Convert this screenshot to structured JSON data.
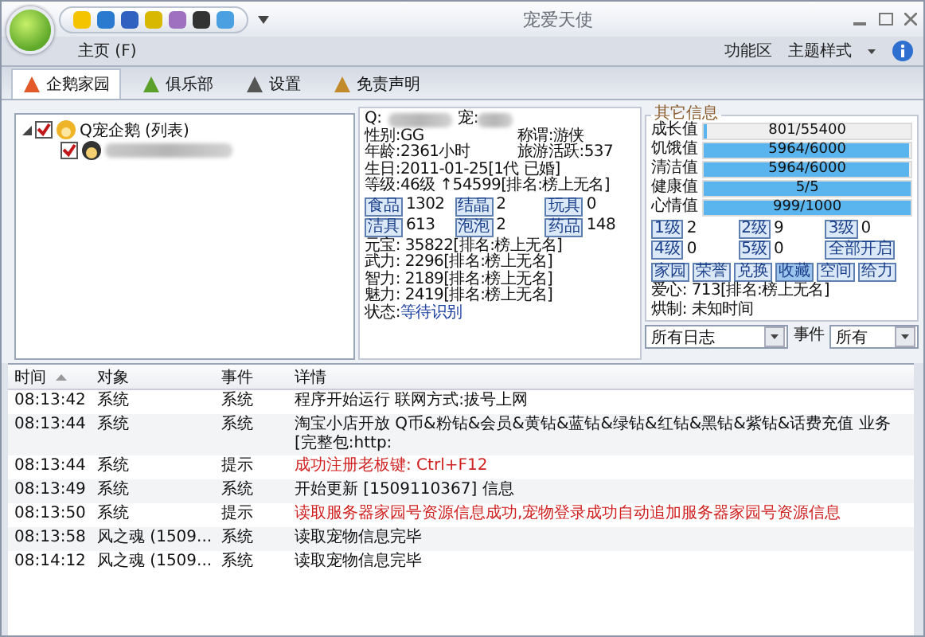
{
  "window": {
    "title": "宠爱天使"
  },
  "menu": {
    "left": [
      {
        "label": "主页 (F)"
      }
    ],
    "right": [
      {
        "label": "功能区"
      },
      {
        "label": "主题样式"
      }
    ]
  },
  "tabs": [
    {
      "label": "企鹅家园",
      "selected": true
    },
    {
      "label": "俱乐部",
      "selected": false
    },
    {
      "label": "设置",
      "selected": false
    },
    {
      "label": "免责声明",
      "selected": false
    }
  ],
  "tree": [
    {
      "label": "Q宠企鹅 (列表)",
      "checked": true,
      "expanded": true,
      "children": [
        {
          "checked": true
        }
      ]
    }
  ],
  "pet_info": {
    "q_label": "Q:",
    "pet_label": "宠:",
    "rows_top": [
      [
        "性别:GG",
        "称谓:游侠"
      ],
      [
        "年龄:2361小时",
        "旅游活跃:537"
      ],
      [
        "生日:2011-01-25[1代 已婚]"
      ],
      [
        "等级:46级 ↑54599[排名:榜上无名]"
      ]
    ],
    "items": [
      {
        "label": "食品",
        "value": "1302"
      },
      {
        "label": "结晶",
        "value": "2"
      },
      {
        "label": "玩具",
        "value": "0"
      },
      {
        "label": "洁具",
        "value": "613"
      },
      {
        "label": "泡泡",
        "value": "2"
      },
      {
        "label": "药品",
        "value": "148"
      }
    ],
    "rows_bottom": [
      "元宝: 35822[排名:榜上无名]",
      "武力: 2296[排名:榜上无名]",
      "智力: 2189[排名:榜上无名]",
      "魅力: 2419[排名:榜上无名]"
    ],
    "status": {
      "label": "状态:",
      "value": "等待识别"
    }
  },
  "other_info": {
    "title": "其它信息",
    "meters": [
      {
        "label": "成长值",
        "reading": "801/55400",
        "level": 0.015
      },
      {
        "label": "饥饿值",
        "reading": "5964/6000",
        "level": 0.994
      },
      {
        "label": "清洁值",
        "reading": "5964/6000",
        "level": 0.994
      },
      {
        "label": "健康值",
        "reading": "5/5",
        "level": 1
      },
      {
        "label": "心情值",
        "reading": "999/1000",
        "level": 0.999
      }
    ],
    "grades": [
      {
        "label": "1级",
        "value": "2"
      },
      {
        "label": "2级",
        "value": "9"
      },
      {
        "label": "3级",
        "value": "0"
      },
      {
        "label": "4级",
        "value": "0"
      },
      {
        "label": "5级",
        "value": "0"
      }
    ],
    "open_all": "全部开启",
    "actions": [
      {
        "label": "家园",
        "selected": false
      },
      {
        "label": "荣誉",
        "selected": false
      },
      {
        "label": "兑换",
        "selected": false
      },
      {
        "label": "收藏",
        "selected": true
      },
      {
        "label": "空间",
        "selected": false
      },
      {
        "label": "给力",
        "selected": false
      }
    ],
    "love": "爱心: 713[排名:榜上无名]",
    "cooldown": "烘制: 未知时间"
  },
  "filters": {
    "log_select": "所有日志",
    "event_label": "事件",
    "event_select": "所有"
  },
  "log": {
    "columns": [
      {
        "label": "时间",
        "sorted": true
      },
      {
        "label": "对象",
        "sorted": false
      },
      {
        "label": "事件",
        "sorted": false
      },
      {
        "label": "详情",
        "sorted": false
      }
    ],
    "rows": [
      {
        "time": "08:13:42",
        "object": "系统",
        "event": "系统",
        "detail": "程序开始运行 联网方式:拔号上网",
        "kind": "normal"
      },
      {
        "time": "08:13:44",
        "object": "系统",
        "event": "系统",
        "detail": "淘宝小店开放 Q币&粉钻&会员&黄钻&蓝钻&绿钻&红钻&黑钻&紫钻&话费充值 业务[完整包:http:",
        "kind": "normal"
      },
      {
        "time": "08:13:44",
        "object": "系统",
        "event": "提示",
        "detail": "成功注册老板键: Ctrl+F12",
        "kind": "notice"
      },
      {
        "time": "08:13:49",
        "object": "系统",
        "event": "系统",
        "detail": "开始更新 [1509110367] 信息",
        "kind": "normal"
      },
      {
        "time": "08:13:50",
        "object": "系统",
        "event": "提示",
        "detail": "读取服务器家园号资源信息成功,宠物登录成功自动追加服务器家园号资源信息",
        "kind": "notice"
      },
      {
        "time": "08:13:58",
        "object": "风之魂 (1509...",
        "event": "系统",
        "detail": "读取宠物信息完毕",
        "kind": "normal"
      },
      {
        "time": "08:14:12",
        "object": "风之魂 (1509...",
        "event": "系统",
        "detail": "读取宠物信息完毕",
        "kind": "normal"
      }
    ]
  }
}
